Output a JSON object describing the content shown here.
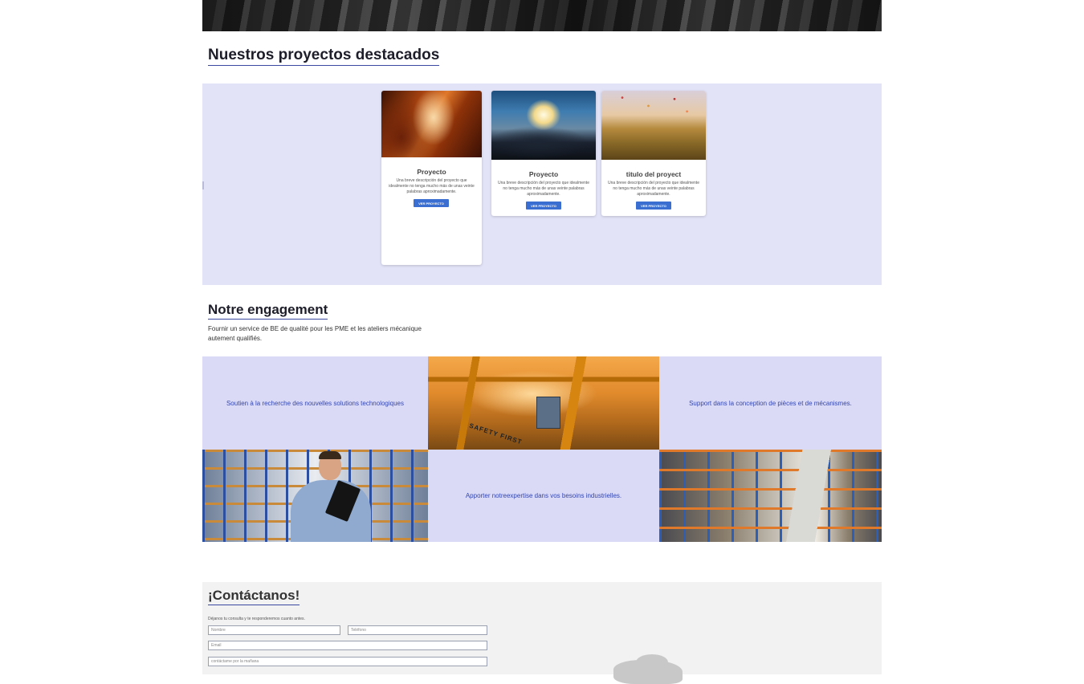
{
  "projects": {
    "title": "Nuestros proyectos destacados",
    "cards": [
      {
        "image": "antelope-canyon-photo",
        "title": "Proyecto",
        "description": "Una breve descripción del proyecto que idealmente no tenga mucho más de unas veinte palabras aproximadamente.",
        "button": "VER PROYECTO"
      },
      {
        "image": "sunset-clouds-photo",
        "title": "Proyecto",
        "description": "Una breve descripción del proyecto que idealmente no tenga mucho más de unas veinte palabras aproximadamente.",
        "button": "VER PROYECTO"
      },
      {
        "image": "hot-air-balloons-photo",
        "title": "titulo del proyect",
        "description": "Una breve descripción del proyecto que idealmente no tenga mucho más de unas veinte palabras aproximadamente.",
        "button": "VER PROYECTO"
      }
    ]
  },
  "engagement": {
    "title": "Notre engagement",
    "description": "Fournir un service de BE de qualité pour les PME et les ateliers mécanique autement qualifiés.",
    "tiles": {
      "research": "Soutien à la recherche des nouvelles solutions technologiques",
      "crane_sign": "SAFETY FIRST",
      "support": "Support dans la conception de pièces et de mécanismes.",
      "expertise": "Apporter notreexpertise dans vos besoins industrielles."
    }
  },
  "contact": {
    "title": "¡Contáctanos!",
    "subtitle": "Déjanos tu consulta y te responderemos cuanto antes.",
    "fields": {
      "name_placeholder": "Nombre",
      "phone_placeholder": "Teléfono",
      "email_placeholder": "Email",
      "time_placeholder": "contáctame por la mañana"
    }
  },
  "colors": {
    "band": "#e3e3f8",
    "tile": "#dadaf7",
    "accent_text": "#3346b0",
    "button": "#3a6fd1"
  }
}
